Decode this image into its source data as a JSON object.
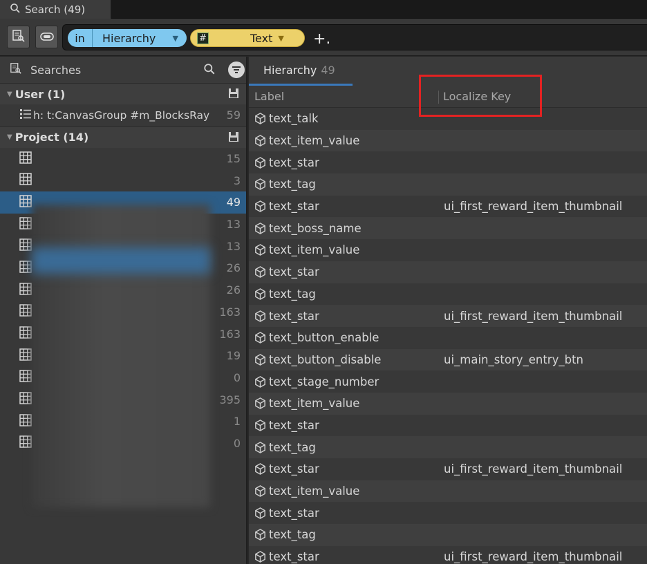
{
  "window_tab": {
    "title": "Search (49)",
    "icon": "search-icon"
  },
  "toolbar": {
    "left_buttons": [
      "inspect-search-icon",
      "toggle-icon"
    ],
    "pill_in": {
      "prefix": "in",
      "value": "Hierarchy"
    },
    "pill_type": {
      "badge": "#",
      "value": "Text"
    },
    "add_icon": "+."
  },
  "left_panel": {
    "header_label": "Searches",
    "user_group": {
      "label": "User (1)",
      "item": {
        "text": "h: t:CanvasGroup #m_BlocksRay",
        "count": "59"
      }
    },
    "project_group": {
      "label": "Project (14)",
      "rows": [
        {
          "count": "15"
        },
        {
          "count": "3"
        },
        {
          "count": "49",
          "selected": true
        },
        {
          "count": "13"
        },
        {
          "count": "13"
        },
        {
          "count": "26"
        },
        {
          "count": "26"
        },
        {
          "count": "163"
        },
        {
          "count": "163"
        },
        {
          "count": "19"
        },
        {
          "count": "0"
        },
        {
          "count": "395"
        },
        {
          "count": "1"
        },
        {
          "count": "0"
        }
      ]
    }
  },
  "right_panel": {
    "tab_label": "Hierarchy",
    "tab_count": "49",
    "columns": {
      "label": "Label",
      "localize_key": "Localize Key"
    },
    "rows": [
      {
        "label": "text_talk",
        "key": ""
      },
      {
        "label": "text_item_value",
        "key": ""
      },
      {
        "label": "text_star",
        "key": ""
      },
      {
        "label": "text_tag",
        "key": ""
      },
      {
        "label": "text_star",
        "key": "ui_first_reward_item_thumbnail"
      },
      {
        "label": "text_boss_name",
        "key": ""
      },
      {
        "label": "text_item_value",
        "key": ""
      },
      {
        "label": "text_star",
        "key": ""
      },
      {
        "label": "text_tag",
        "key": ""
      },
      {
        "label": "text_star",
        "key": "ui_first_reward_item_thumbnail"
      },
      {
        "label": "text_button_enable",
        "key": ""
      },
      {
        "label": "text_button_disable",
        "key": "ui_main_story_entry_btn"
      },
      {
        "label": "text_stage_number",
        "key": ""
      },
      {
        "label": "text_item_value",
        "key": ""
      },
      {
        "label": "text_star",
        "key": ""
      },
      {
        "label": "text_tag",
        "key": ""
      },
      {
        "label": "text_star",
        "key": "ui_first_reward_item_thumbnail"
      },
      {
        "label": "text_item_value",
        "key": ""
      },
      {
        "label": "text_star",
        "key": ""
      },
      {
        "label": "text_tag",
        "key": ""
      },
      {
        "label": "text_star",
        "key": "ui_first_reward_item_thumbnail"
      }
    ]
  },
  "colors": {
    "accent": "#2c5d87",
    "highlight": "#e32222",
    "pill_blue": "#7fc8ef",
    "pill_yellow": "#ecd16a"
  }
}
